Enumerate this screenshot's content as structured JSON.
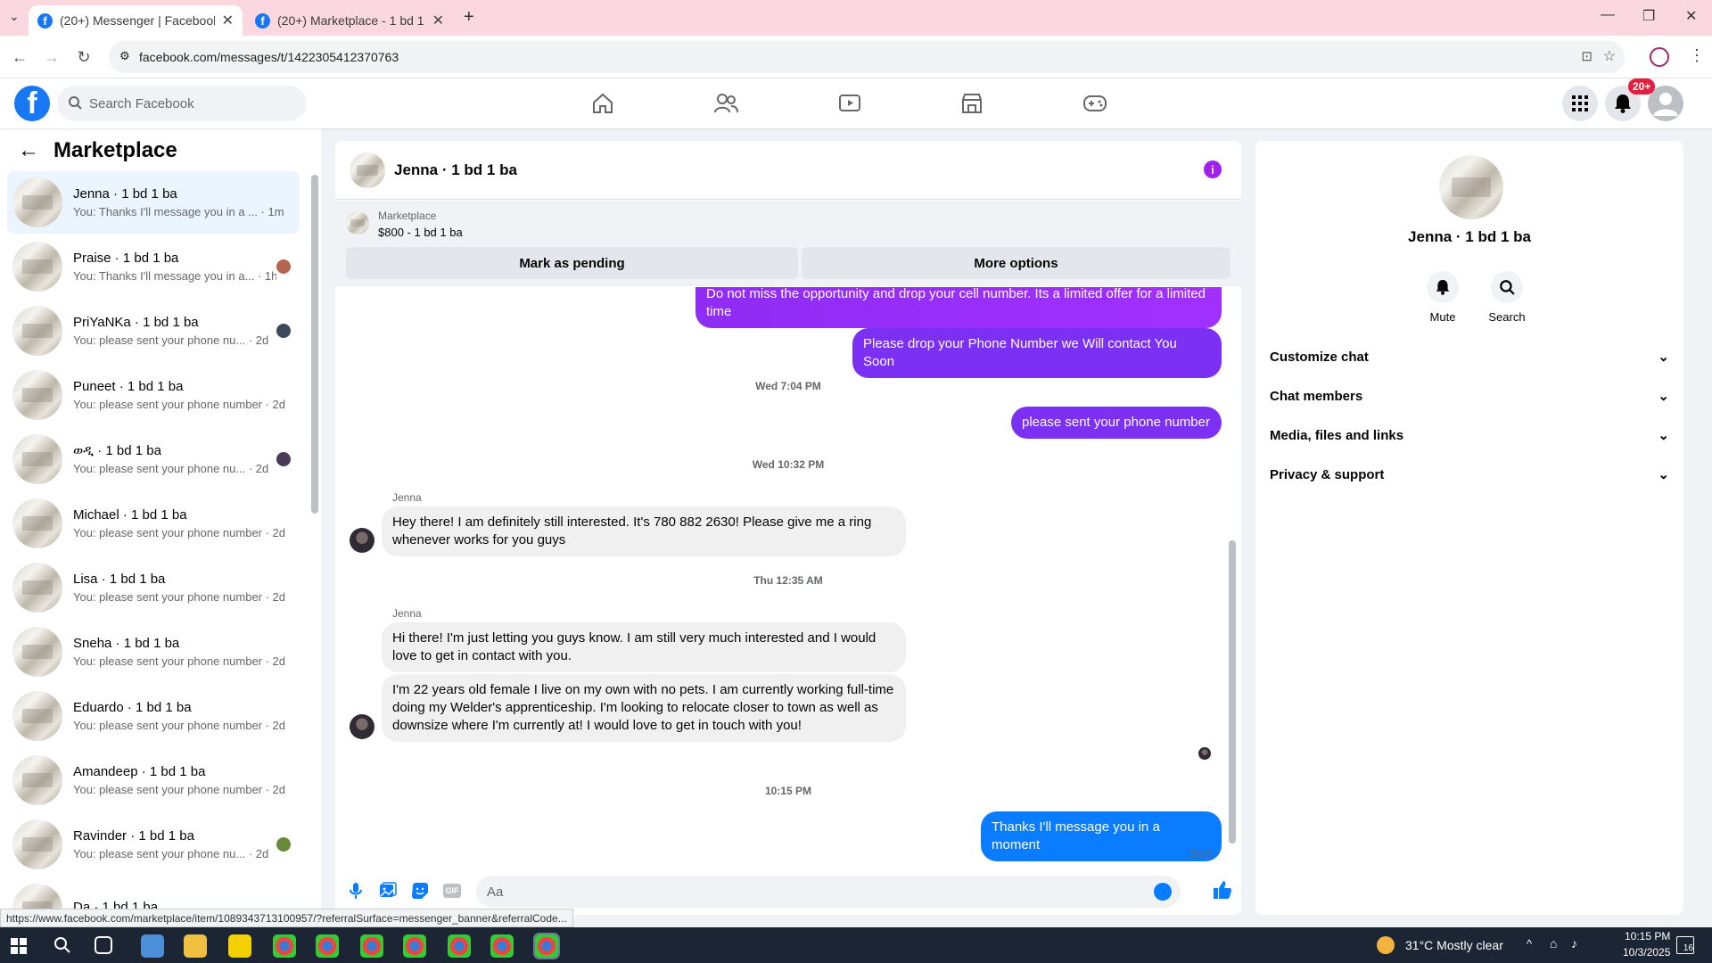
{
  "browser": {
    "tabs": [
      {
        "title": "(20+) Messenger | Facebook",
        "active": true
      },
      {
        "title": "(20+) Marketplace - 1 bd 1 ba",
        "active": false
      }
    ],
    "url": "facebook.com/messages/t/1422305412370763"
  },
  "fb": {
    "search_placeholder": "Search Facebook",
    "notif_badge": "20+"
  },
  "sidebar": {
    "title": "Marketplace",
    "conversations": [
      {
        "name": "Jenna · 1 bd 1 ba",
        "preview": "You: Thanks I'll message you in a ... · 1m",
        "selected": true
      },
      {
        "name": "Praise · 1 bd 1 ba",
        "preview": "You: Thanks I'll message you in a... · 1h"
      },
      {
        "name": "PriYaNKa · 1 bd 1 ba",
        "preview": "You: please sent your phone nu... · 2d"
      },
      {
        "name": "Puneet · 1 bd 1 ba",
        "preview": "You: please sent your phone number · 2d"
      },
      {
        "name": "ወዲ · 1 bd 1 ba",
        "preview": "You: please sent your phone nu... · 2d"
      },
      {
        "name": "Michael · 1 bd 1 ba",
        "preview": "You: please sent your phone number · 2d"
      },
      {
        "name": "Lisa · 1 bd 1 ba",
        "preview": "You: please sent your phone number · 2d"
      },
      {
        "name": "Sneha · 1 bd 1 ba",
        "preview": "You: please sent your phone number · 2d"
      },
      {
        "name": "Eduardo · 1 bd 1 ba",
        "preview": "You: please sent your phone number · 2d"
      },
      {
        "name": "Amandeep · 1 bd 1 ba",
        "preview": "You: please sent your phone number · 2d"
      },
      {
        "name": "Ravinder · 1 bd 1 ba",
        "preview": "You: please sent your phone nu... · 2d"
      },
      {
        "name": "Da · 1 bd 1 ba",
        "preview": ""
      }
    ]
  },
  "chat": {
    "title": "Jenna · 1 bd 1 ba",
    "banner_label": "Marketplace",
    "banner_item": "$800 - 1 bd 1 ba",
    "mark_pending": "Mark as pending",
    "more_options": "More options",
    "messages": {
      "m1": "Do not miss the opportunity and drop your cell number. Its a limited offer for a limited time",
      "m2": "Please drop your Phone Number we Will contact You Soon",
      "ts1": "Wed 7:04 PM",
      "m3": "please sent your phone number",
      "ts2": "Wed 10:32 PM",
      "sender1": "Jenna",
      "m4": "Hey there! I am definitely still interested. It's 780 882 2630! Please give me a ring whenever works for you guys",
      "ts3": "Thu 12:35 AM",
      "sender2": "Jenna",
      "m5": "Hi there! I'm just letting you guys know. I am still very much interested and I would love to get in contact with you.",
      "m6": "I'm 22 years old female I live on my own with no pets. I am currently working full-time doing my Welder's apprenticeship. I'm looking to relocate closer to town as well as downsize where I'm currently at! I would love to get in touch with you!",
      "ts4": "10:15 PM",
      "m7": "Thanks I'll message you in a moment",
      "status": "Sent"
    },
    "input_placeholder": "Aa"
  },
  "info": {
    "name": "Jenna · 1 bd 1 ba",
    "mute": "Mute",
    "search": "Search",
    "rows": [
      "Customize chat",
      "Chat members",
      "Media, files and links",
      "Privacy & support"
    ]
  },
  "status_url": "https://www.facebook.com/marketplace/item/1089343713100957/?referralSurface=messenger_banner&referralCode...",
  "taskbar": {
    "weather": "31°C  Mostly clear",
    "time": "10:15 PM",
    "date": "10/3/2025",
    "notif": "16"
  },
  "colors": {
    "fb_blue": "#1877f2",
    "outgoing_purple": "#a033ff",
    "outgoing_blue": "#0a7cff",
    "badge_red": "#e41e3f"
  }
}
